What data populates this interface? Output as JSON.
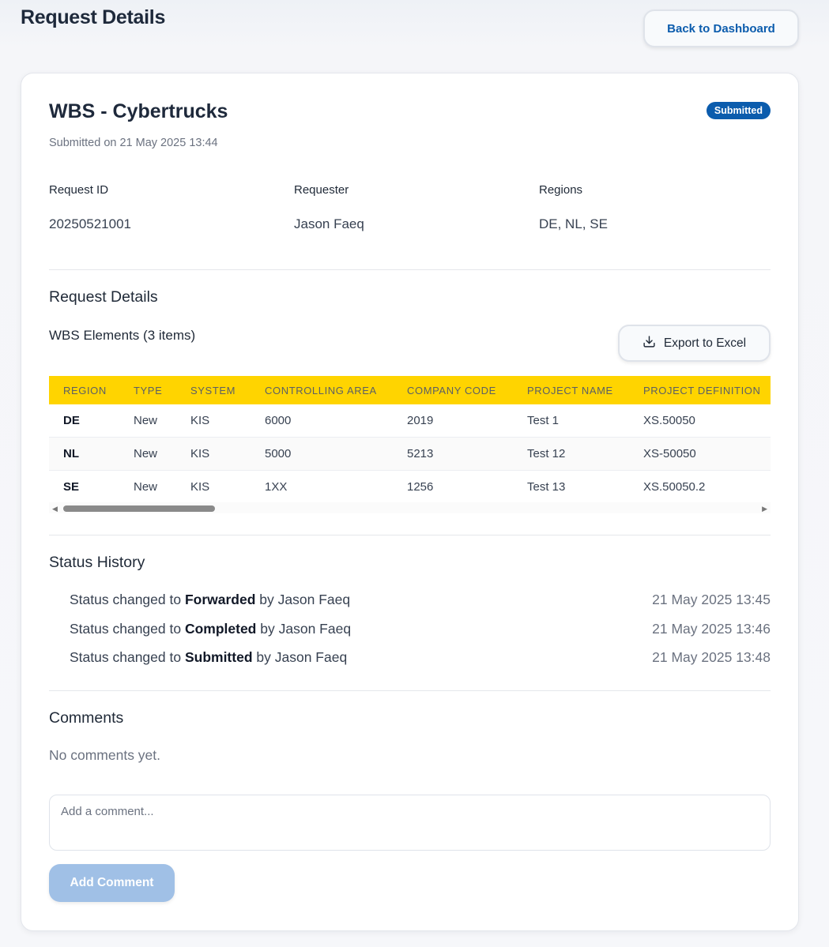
{
  "header": {
    "title": "Request Details",
    "back_label": "Back to Dashboard"
  },
  "request": {
    "title": "WBS - Cybertrucks",
    "status_badge": "Submitted",
    "submitted_on": "Submitted on 21 May 2025 13:44",
    "fields": [
      {
        "label": "Request ID",
        "value": "20250521001"
      },
      {
        "label": "Requester",
        "value": "Jason Faeq"
      },
      {
        "label": "Regions",
        "value": "DE, NL, SE"
      }
    ]
  },
  "details": {
    "section_title": "Request Details",
    "wbs_count": "WBS Elements (3 items)",
    "export_label": "Export to Excel",
    "columns": [
      "REGION",
      "TYPE",
      "SYSTEM",
      "CONTROLLING AREA",
      "COMPANY CODE",
      "PROJECT NAME",
      "PROJECT DEFINITION"
    ],
    "rows": [
      [
        "DE",
        "New",
        "KIS",
        "6000",
        "2019",
        "Test 1",
        "XS.50050"
      ],
      [
        "NL",
        "New",
        "KIS",
        "5000",
        "5213",
        "Test 12",
        "XS-50050"
      ],
      [
        "SE",
        "New",
        "KIS",
        "1XX",
        "1256",
        "Test 13",
        "XS.50050.2"
      ]
    ]
  },
  "history": {
    "section_title": "Status History",
    "prefix": "Status changed to",
    "by": "by",
    "items": [
      {
        "status": "Forwarded",
        "user": "Jason Faeq",
        "time": "21 May 2025 13:45"
      },
      {
        "status": "Completed",
        "user": "Jason Faeq",
        "time": "21 May 2025 13:46"
      },
      {
        "status": "Submitted",
        "user": "Jason Faeq",
        "time": "21 May 2025 13:48"
      }
    ]
  },
  "comments": {
    "section_title": "Comments",
    "empty_text": "No comments yet.",
    "placeholder": "Add a comment...",
    "add_label": "Add Comment"
  },
  "colors": {
    "accent": "#0b5cad",
    "table_header": "#ffd400",
    "disabled_button": "#a0c0e6"
  }
}
